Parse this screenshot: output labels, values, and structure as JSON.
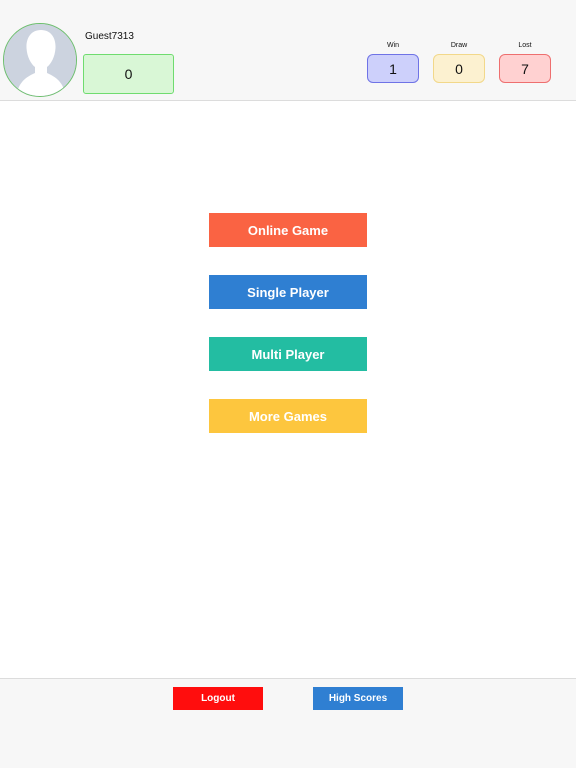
{
  "profile": {
    "username": "Guest7313",
    "score": "0"
  },
  "stats": {
    "win_label": "Win",
    "win_value": "1",
    "draw_label": "Draw",
    "draw_value": "0",
    "lost_label": "Lost",
    "lost_value": "7"
  },
  "menu": {
    "online_game": "Online Game",
    "single_player": "Single Player",
    "multi_player": "Multi Player",
    "more_games": "More Games"
  },
  "footer": {
    "logout": "Logout",
    "high_scores": "High Scores"
  },
  "colors": {
    "online_game": "#fa6343",
    "single_player": "#2f7fd2",
    "multi_player": "#23bda2",
    "more_games": "#fdc63e",
    "logout": "#ff0d0d",
    "high_scores": "#2f7fd2"
  },
  "icons": {
    "avatar": "person-silhouette-icon"
  }
}
